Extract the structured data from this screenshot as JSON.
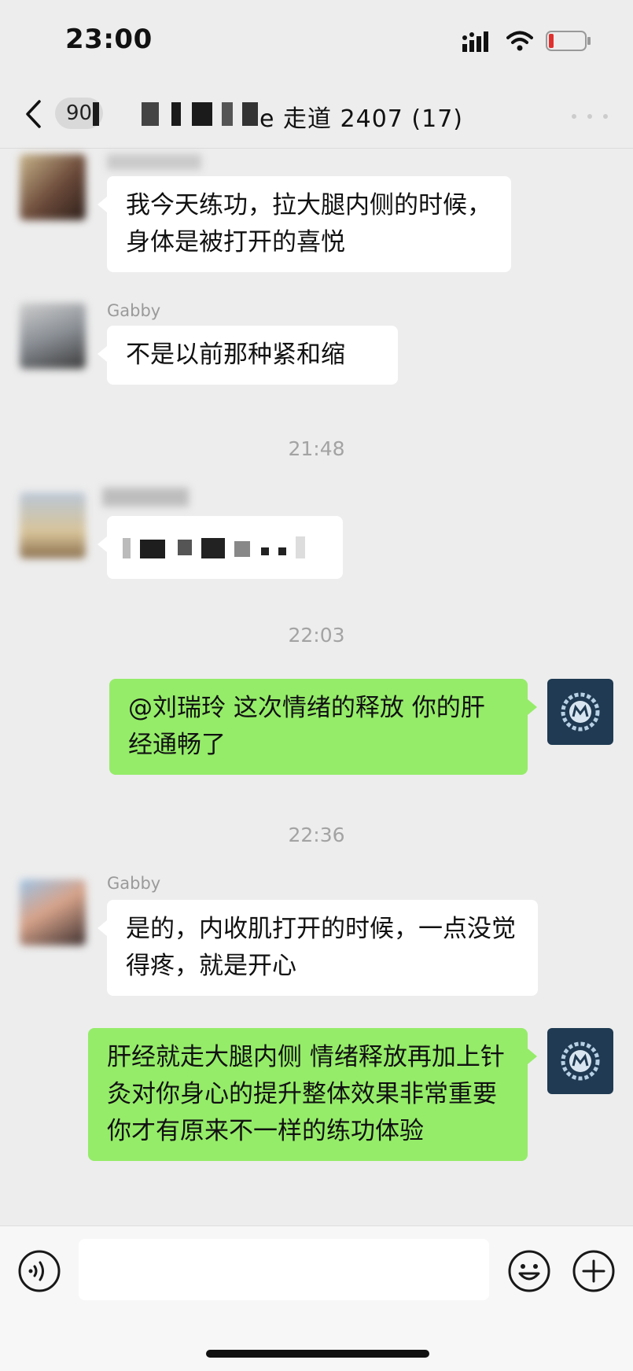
{
  "status_bar": {
    "time": "23:00"
  },
  "nav": {
    "unread_count": "90",
    "title_visible": "e 走道 2407 (17)"
  },
  "messages": [
    {
      "id": "m1",
      "direction": "in",
      "sender": "",
      "text": "我今天练功，拉大腿内侧的时候，身体是被打开的喜悦"
    },
    {
      "id": "m2",
      "direction": "in",
      "sender": "Gabby",
      "text": "不是以前那种紧和缩"
    },
    {
      "id": "m3",
      "direction": "in",
      "sender": "",
      "text": ""
    },
    {
      "id": "m4",
      "direction": "out",
      "text": "@刘瑞玲 这次情绪的释放 你的肝经通畅了"
    },
    {
      "id": "m5",
      "direction": "in",
      "sender": "Gabby",
      "text": "是的，内收肌打开的时候，一点没觉得疼，就是开心"
    },
    {
      "id": "m6",
      "direction": "out",
      "text": "肝经就走大腿内侧 情绪释放再加上针灸对你身心的提升整体效果非常重要 你才有原来不一样的练功体验"
    }
  ],
  "timestamps": [
    "21:48",
    "22:03",
    "22:36"
  ],
  "bubble_colors": {
    "incoming": "#ffffff",
    "outgoing": "#95ec69",
    "background": "#ededed"
  },
  "icons": {
    "back": "chevron-left-icon",
    "voice": "voice-icon",
    "emoji": "emoji-icon",
    "plus": "plus-icon",
    "signal": "signal-icon",
    "wifi": "wifi-icon",
    "battery": "battery-low-icon"
  }
}
